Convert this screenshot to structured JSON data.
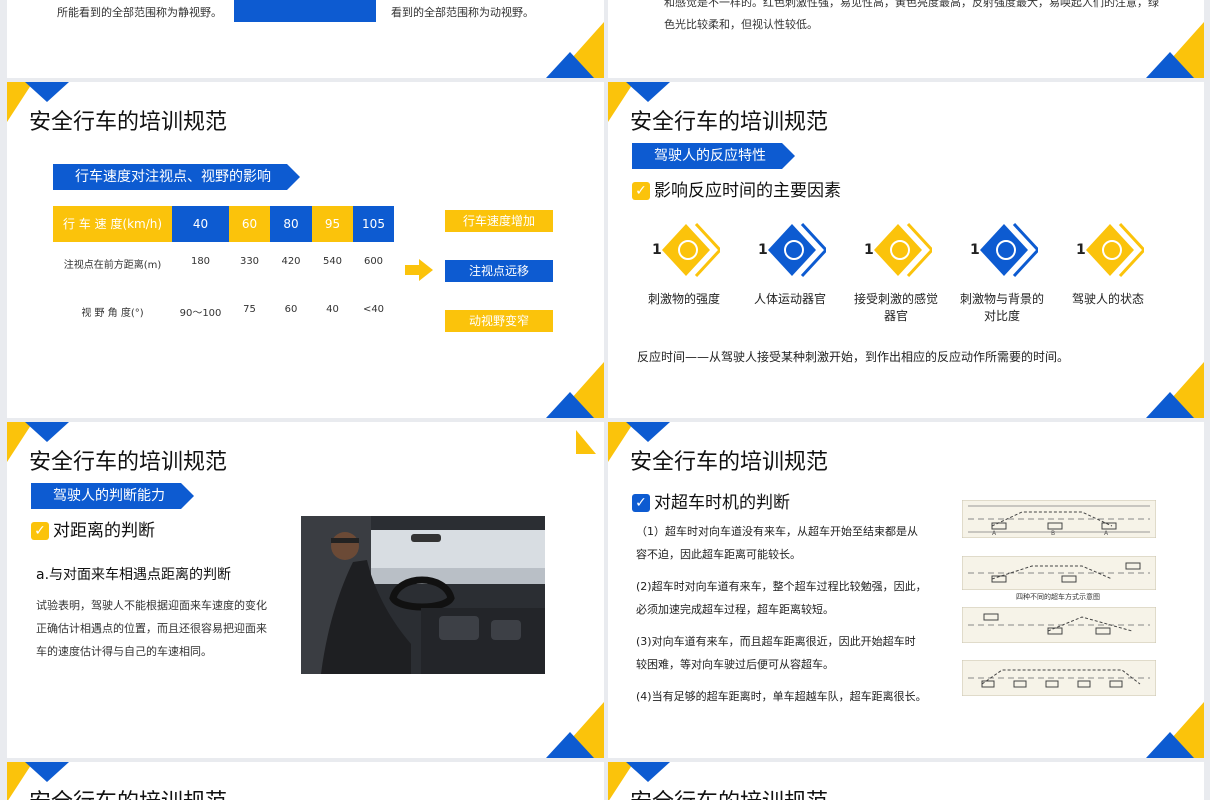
{
  "colors": {
    "blue": "#0d5bd1",
    "yellow": "#fbc30b"
  },
  "top_left": {
    "text": "所能看到的全部范围称为静视野。"
  },
  "top_mid": {
    "text": "看到的全部范围称为动视野。"
  },
  "top_right": {
    "line1": "和感觉是不一样的。红色刺激性强，易见性高，黄色亮度最高，反射强度最大，易唤起人们的注意，绿",
    "line2": "色光比较柔和，但视认性较低。"
  },
  "slide_title": "安全行车的培训规范",
  "s1": {
    "tag": "行车速度对注视点、视野的影响",
    "row_speed": {
      "label": "行 车 速 度(km/h)",
      "values": [
        "40",
        "60",
        "80",
        "95",
        "105"
      ]
    },
    "row_dist": {
      "label": "注视点在前方距离(m)",
      "values": [
        "180",
        "330",
        "420",
        "540",
        "600"
      ]
    },
    "row_angle": {
      "label": "视 野 角 度(°)",
      "values": [
        "90～100",
        "75",
        "60",
        "40",
        "<40"
      ]
    },
    "arrow_icon": "right-arrow-icon",
    "results": [
      "行车速度增加",
      "注视点远移",
      "动视野变窄"
    ]
  },
  "s2": {
    "tag": "驾驶人的反应特性",
    "heading": "影响反应时间的主要因素",
    "factors": [
      {
        "num": "1",
        "label": "刺激物的强度",
        "color": "yellow"
      },
      {
        "num": "1",
        "label": "人体运动器官",
        "color": "blue"
      },
      {
        "num": "1",
        "label": "接受刺激的感觉器官",
        "color": "yellow"
      },
      {
        "num": "1",
        "label": "刺激物与背景的对比度",
        "color": "blue"
      },
      {
        "num": "1",
        "label": "驾驶人的状态",
        "color": "yellow"
      }
    ],
    "definition": "反应时间——从驾驶人接受某种刺激开始，到作出相应的反应动作所需要的时间。"
  },
  "s3": {
    "tag": "驾驶人的判断能力",
    "heading": "对距离的判断",
    "subheading": "a.与对面来车相遇点距离的判断",
    "para_lines": [
      "试验表明，驾驶人不能根据迎面来车速度的变化",
      "正确估计相遇点的位置，而且还很容易把迎面来",
      "车的速度估计得与自己的车速相同。"
    ],
    "photo": "driver-photo"
  },
  "s4": {
    "heading": "对超车时机的判断",
    "paras": [
      [
        "（1）超车时对向车道没有来车，从超车开始至结束都是从",
        "容不迫，因此超车距离可能较长。"
      ],
      [
        "(2)超车时对向车道有来车，整个超车过程比较勉强，因此，",
        "必须加速完成超车过程，超车距离较短。"
      ],
      [
        "(3)对向车道有来车，而且超车距离很近，因此开始超车时",
        "较困难，等对向车驶过后便可从容超车。"
      ],
      [
        "(4)当有足够的超车距离时，单车超越车队，超车距离很长。"
      ]
    ],
    "diagram_caption": "四种不同的超车方式示意图",
    "diagram_labels": [
      "A",
      "B",
      "A"
    ]
  }
}
